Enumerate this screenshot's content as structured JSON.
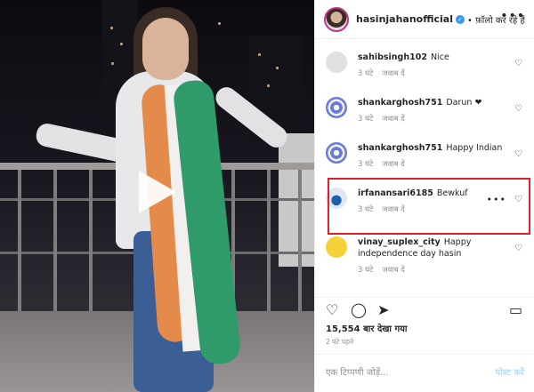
{
  "post": {
    "username": "hasinjahanofficial",
    "follow_text": "• फ़ॉलो कर रहे हैं"
  },
  "comments": [
    {
      "username": "sahibsingh102",
      "text": "Nice",
      "time": "3 घंटे",
      "reply": "जवाब दें"
    },
    {
      "username": "shankarghosh751",
      "text": "Darun ❤",
      "time": "3 घंटे",
      "reply": "जवाब दें"
    },
    {
      "username": "shankarghosh751",
      "text": "Happy Indian",
      "time": "3 घंटे",
      "reply": "जवाब दें"
    },
    {
      "username": "irfanansari6185",
      "text": "Bewkuf",
      "time": "3 घंटे",
      "reply": "जवाब दें"
    },
    {
      "username": "vinay_suplex_city",
      "text": "Happy independence day hasin",
      "time": "3 घंटे",
      "reply": "जवाब दें"
    }
  ],
  "stats": {
    "views": "15,554 बार देखा गया",
    "date": "2 घंटे पहले"
  },
  "composer": {
    "placeholder": "एक टिप्पणी जोड़ें...",
    "post_label": "पोस्ट करें"
  },
  "icons": {
    "more": "more-horizontal-icon",
    "heart": "heart-icon",
    "comment": "comment-icon",
    "share": "share-icon",
    "save": "bookmark-icon",
    "play": "play-icon"
  }
}
